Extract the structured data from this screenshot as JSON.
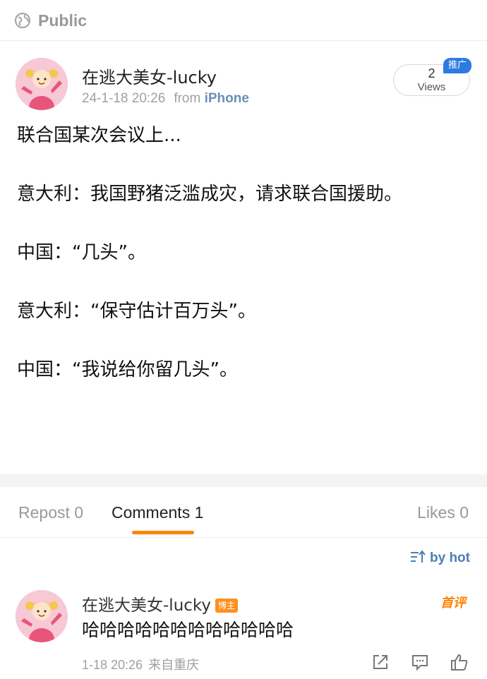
{
  "header": {
    "visibility": "Public",
    "icon": "globe-icon"
  },
  "post": {
    "author": "在逃大美女-lucky",
    "time": "24-1-18 20:26",
    "from_label": "from",
    "device": "iPhone",
    "views_count": "2",
    "views_label": "Views",
    "promo": "推广",
    "paragraphs": [
      "联合国某次会议上...",
      "意大利：我国野猪泛滥成灾，请求联合国援助。",
      "中国：“几头”。",
      "意大利：“保守估计百万头”。",
      "中国：“我说给你留几头”。"
    ]
  },
  "tabs": {
    "repost": "Repost 0",
    "comments": "Comments 1",
    "likes": "Likes 0"
  },
  "sort": {
    "label": "by hot",
    "icon": "sort-icon"
  },
  "comment": {
    "author": "在逃大美女-lucky",
    "badge": "博主",
    "first_tag": "首评",
    "text": "哈哈哈哈哈哈哈哈哈哈哈哈",
    "time": "1-18 20:26",
    "location": "来自重庆"
  },
  "colors": {
    "accent": "#ff8200",
    "link": "#6b8fb8",
    "promo": "#2e7be0"
  }
}
